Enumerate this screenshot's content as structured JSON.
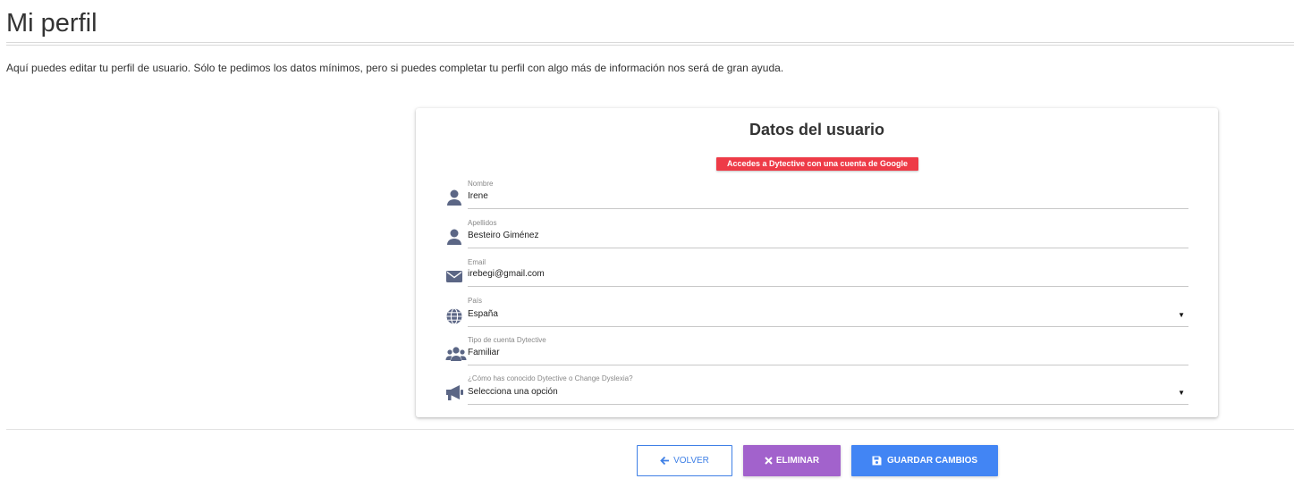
{
  "page": {
    "title": "Mi perfil",
    "intro": "Aquí puedes editar tu perfil de usuario. Sólo te pedimos los datos mínimos, pero si puedes completar tu perfil con algo más de información nos será de gran ayuda."
  },
  "card": {
    "title": "Datos del usuario",
    "google_badge": "Accedes a Dytective con una cuenta de Google",
    "fields": [
      {
        "label": "Nombre",
        "value": "Irene",
        "icon": "person-icon"
      },
      {
        "label": "Apellidos",
        "value": "Besteiro Giménez",
        "icon": "person-icon"
      },
      {
        "label": "Email",
        "value": "irebegi@gmail.com",
        "icon": "envelope-icon"
      },
      {
        "label": "País",
        "value": "España",
        "icon": "globe-icon"
      },
      {
        "label": "Tipo de cuenta Dytective",
        "value": "Familiar",
        "icon": "users-icon"
      },
      {
        "label": "¿Cómo has conocido Dytective o Change Dyslexia?",
        "value": "Selecciona una opción",
        "icon": "megaphone-icon"
      }
    ]
  },
  "buttons": {
    "back": "VOLVER",
    "delete": "ELIMINAR",
    "save": "GUARDAR CAMBIOS"
  },
  "colors": {
    "icon": "#5b6685",
    "google_badge": "#ee3b47",
    "back_border": "#3f80e6",
    "delete_bg": "#a262cc",
    "save_bg": "#4285f4"
  }
}
